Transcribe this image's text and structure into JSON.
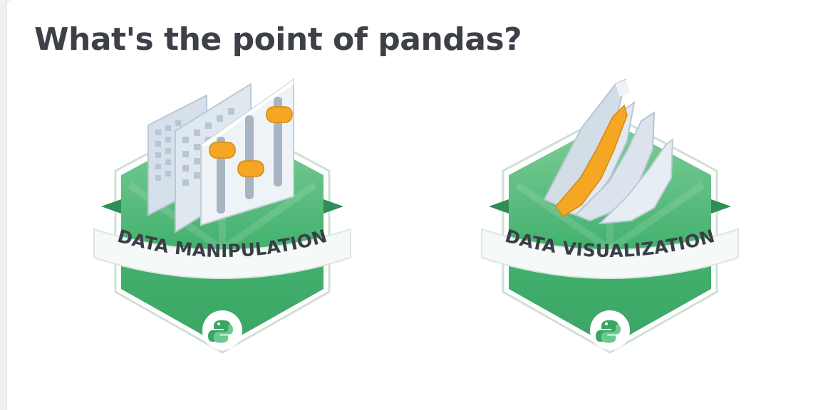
{
  "title": "What's the point of pandas?",
  "badges": [
    {
      "label": "DATA MANIPULATION",
      "illustration": "data-manipulation-sliders",
      "footer_icon": "python-logo-icon"
    },
    {
      "label": "DATA VISUALIZATION",
      "illustration": "data-visualization-mountains",
      "footer_icon": "python-logo-icon"
    }
  ],
  "colors": {
    "title": "#3d4048",
    "badge_green": "#3fae6c",
    "badge_green_light": "#7fcf9a",
    "ribbon": "#f5f9f7",
    "accent_orange": "#f5a623",
    "panel": "#d3dde6"
  }
}
